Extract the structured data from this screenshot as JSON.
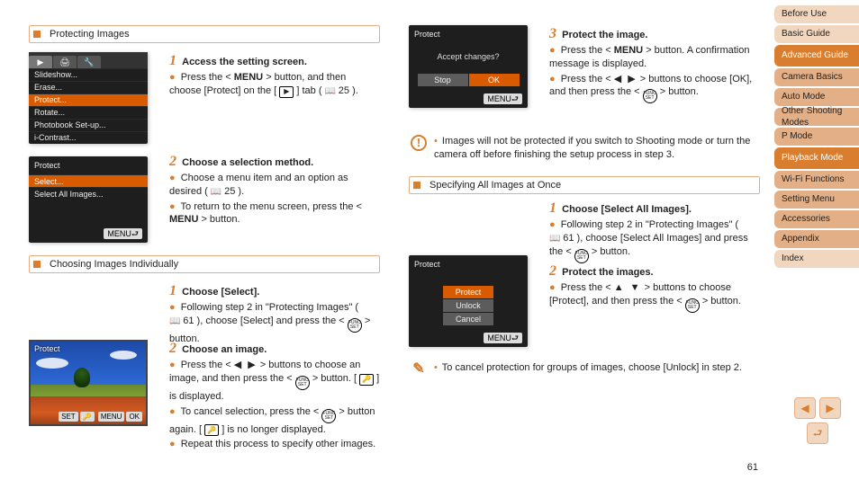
{
  "tabs": [
    "Before Use",
    "Basic Guide",
    "Advanced Guide",
    "Camera Basics",
    "Auto Mode",
    "Other Shooting Modes",
    "P Mode",
    "Playback Mode",
    "Wi-Fi Functions",
    "Setting Menu",
    "Accessories",
    "Appendix",
    "Index"
  ],
  "active_tab_index": 7,
  "sec1": {
    "title": "Protecting Images"
  },
  "sec2": {
    "title": "Choosing Images Individually"
  },
  "sec3": {
    "title": "Specifying All Images at Once"
  },
  "lcd_menu": {
    "tabs": [
      "▶",
      "🖨",
      "🔧"
    ],
    "active_tab": 0,
    "items": [
      "Slideshow...",
      "Erase...",
      "Protect...",
      "Rotate...",
      "Photobook Set-up...",
      "i-Contrast..."
    ],
    "highlight_index": 2
  },
  "lcd_select": {
    "header": "Protect",
    "items": [
      "Select...",
      "Select All Images..."
    ],
    "highlight_index": 0,
    "footer": "MENU⮐"
  },
  "lcd_confirm": {
    "header": "Protect",
    "message": "Accept changes?",
    "buttons": [
      "Stop",
      "OK"
    ],
    "highlight_index": 1,
    "footer": "MENU⮐"
  },
  "lcd_all": {
    "header": "Protect",
    "buttons": [
      "Protect",
      "Unlock",
      "Cancel"
    ],
    "highlight_index": 0,
    "footer": "MENU⮐"
  },
  "photo": {
    "tag": "Protect",
    "footer_set": "SET",
    "footer_key": "🔑",
    "footer_menu": "MENU",
    "footer_ok": "OK"
  },
  "step_protect_1": {
    "num": "1",
    "title": "Access the setting screen.",
    "line1_pre": "Press the <",
    "line1_menu": "MENU",
    "line1_post": "> button, and then choose [Protect] on the [",
    "line1_tab": "▶",
    "line1_post2": "] tab (",
    "line1_ref": "25",
    "line1_end": ")."
  },
  "step_protect_2": {
    "num": "2",
    "title": "Choose a selection method.",
    "line1": "Choose a menu item and an option as desired (",
    "line1_ref": "25",
    "line1_end": ").",
    "line2_pre": "To return to the menu screen, press the <",
    "line2_menu": "MENU",
    "line2_post": "> button."
  },
  "step_indiv_1": {
    "num": "1",
    "title": "Choose [Select].",
    "line1_pre": "Following step 2 in \"Protecting Images\" (",
    "line1_ref": "61",
    "line1_post": "), choose [Select] and press the <",
    "line1_btn": "FUNC SET",
    "line1_end": "> button."
  },
  "step_indiv_2": {
    "num": "2",
    "title": "Choose an image.",
    "line1_pre": "Press the <",
    "line1_arrows": "◀ ▶",
    "line1_mid": "> buttons to choose an image, and then press the <",
    "line1_btn": "FUNC SET",
    "line1_post": "> button. [",
    "line1_key": "🔑",
    "line1_end": "] is displayed.",
    "line2_pre": "To cancel selection, press the <",
    "line2_btn": "FUNC SET",
    "line2_post": "> button again. [",
    "line2_key": "🔑",
    "line2_end": "] is no longer displayed.",
    "line3": "Repeat this process to specify other images."
  },
  "step_confirm_3": {
    "num": "3",
    "title": "Protect the image.",
    "line1_pre": "Press the <",
    "line1_menu": "MENU",
    "line1_post": "> button. A confirmation message is displayed.",
    "line2_pre": "Press the <",
    "line2_arrows": "◀ ▶",
    "line2_mid": "> buttons to choose [OK], and then press the <",
    "line2_btn": "FUNC SET",
    "line2_end": "> button."
  },
  "caution": {
    "text": "Images will not be protected if you switch to Shooting mode or turn the camera off before finishing the setup process in step 3."
  },
  "step_all_1": {
    "num": "1",
    "title": "Choose [Select All Images].",
    "line1_pre": "Following step 2 in \"Protecting Images\" (",
    "line1_ref": "61",
    "line1_post": "), choose [Select All Images] and press the <",
    "line1_btn": "FUNC SET",
    "line1_end": "> button."
  },
  "step_all_2": {
    "num": "2",
    "title": "Protect the images.",
    "line1_pre": "Press the <",
    "line1_arrows": "▲ ▼",
    "line1_mid": "> buttons to choose [Protect], and then press the <",
    "line1_btn": "FUNC SET",
    "line1_end": "> button."
  },
  "note": {
    "text": "To cancel protection for groups of images, choose [Unlock] in step 2."
  },
  "pagenum": "61"
}
